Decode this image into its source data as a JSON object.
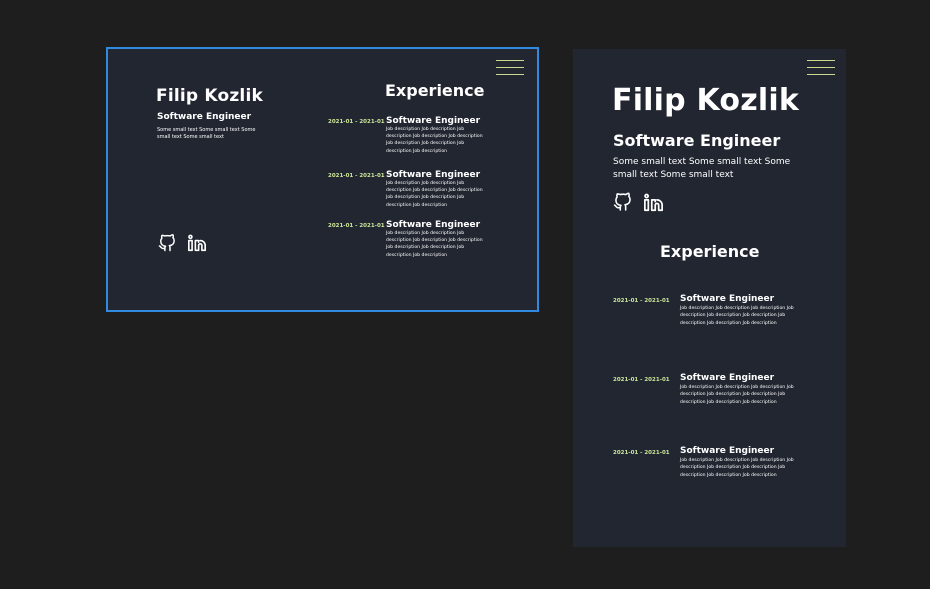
{
  "colors": {
    "canvas": "#1e1e1e",
    "frame_bg": "#212631",
    "selection": "#2f8ae0",
    "accent": "#cde59a",
    "text": "#ffffff"
  },
  "profile": {
    "name": "Filip Kozlik",
    "role": "Software Engineer",
    "blurb": "Some small text Some small text Some small text Some small text"
  },
  "social": [
    {
      "icon": "github-icon"
    },
    {
      "icon": "linkedin-icon"
    }
  ],
  "experience": {
    "title": "Experience",
    "items": [
      {
        "date": "2021-01 - 2021-01",
        "title": "Software Engineer",
        "description": "Job description Job description Job description Job description Job description Job description Job description Job description Job description"
      },
      {
        "date": "2021-01 - 2021-01",
        "title": "Software Engineer",
        "description": "Job description Job description Job description Job description Job description Job description Job description Job description Job description"
      },
      {
        "date": "2021-01 - 2021-01",
        "title": "Software Engineer",
        "description": "Job description Job description Job description Job description Job description Job description Job description Job description Job description"
      }
    ]
  }
}
